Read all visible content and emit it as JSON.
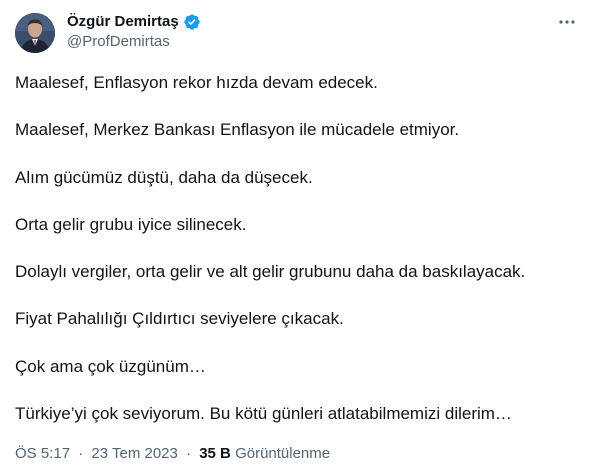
{
  "author": {
    "display_name": "Özgür Demirtaş",
    "handle": "@ProfDemirtas",
    "verified": true,
    "accent_color": "#1d9bf0"
  },
  "icons": {
    "verified": "verified-badge-icon",
    "more": "more-options-icon",
    "avatar": "avatar"
  },
  "tweet": {
    "lines": [
      "Maalesef, Enflasyon rekor hızda devam edecek.",
      "Maalesef, Merkez Bankası Enflasyon ile mücadele etmiyor.",
      "Alım gücümüz düştü, daha da düşecek.",
      "Orta gelir grubu iyice silinecek.",
      "Dolaylı vergiler, orta gelir ve alt gelir grubunu daha da baskılayacak.",
      "Fiyat Pahalılığı Çıldırtıcı seviyelere çıkacak.",
      "Çok ama çok üzgünüm…",
      "Türkiye’yi çok seviyorum. Bu kötü günleri atlatabilmemizi dilerim…"
    ]
  },
  "meta": {
    "time": "ÖS 5:17",
    "separator": "·",
    "date": "23 Tem 2023",
    "views_count": "35 B",
    "views_label": "Görüntülenme"
  }
}
